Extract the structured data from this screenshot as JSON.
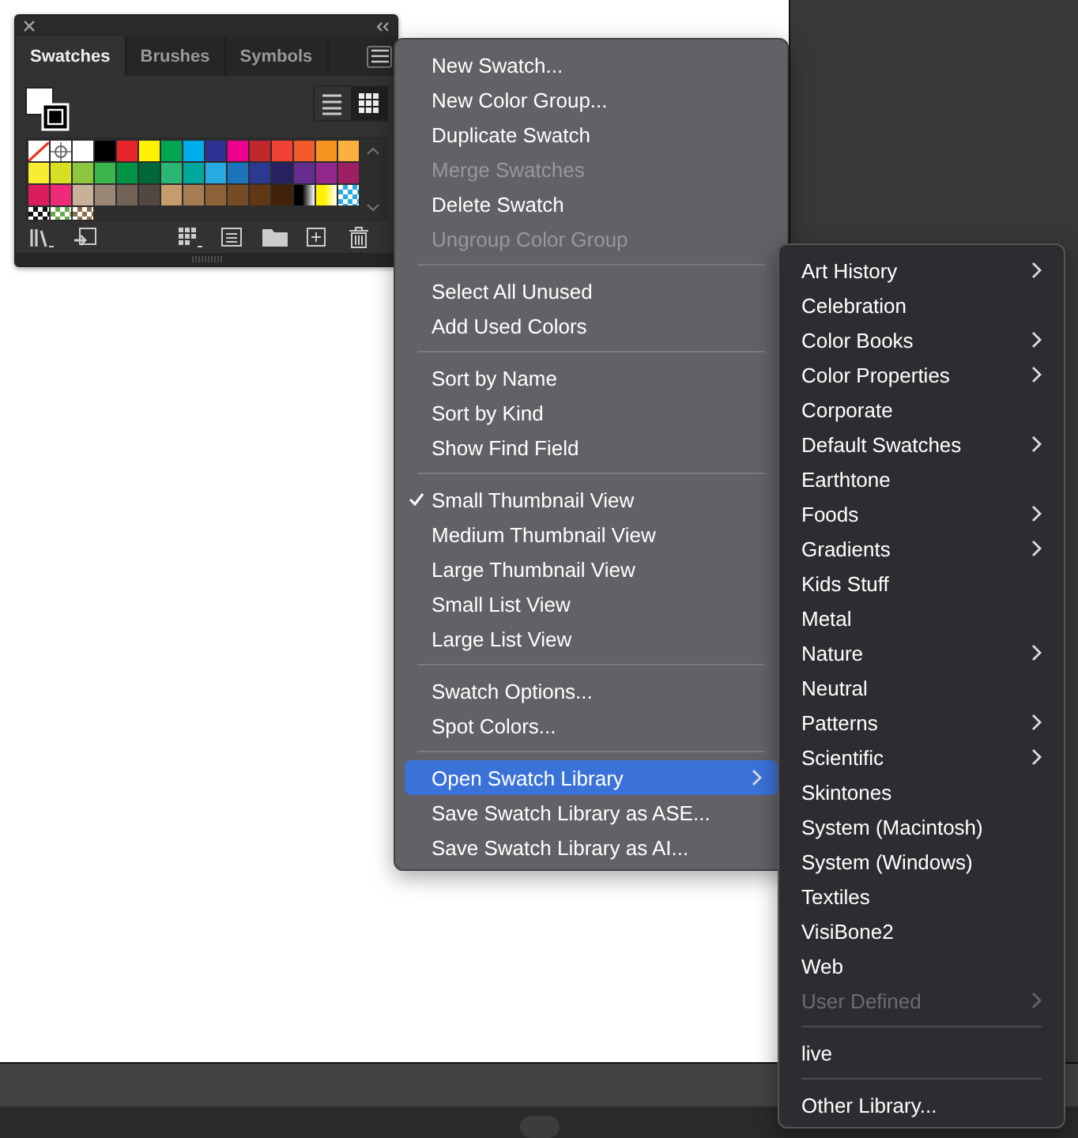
{
  "panel": {
    "tabs": [
      {
        "label": "Swatches",
        "selected": true
      },
      {
        "label": "Brushes",
        "selected": false
      },
      {
        "label": "Symbols",
        "selected": false
      }
    ],
    "views": [
      {
        "kind": "list",
        "selected": false
      },
      {
        "kind": "grid",
        "selected": true
      }
    ],
    "swatches": [
      {
        "kind": "none"
      },
      {
        "kind": "registration"
      },
      {
        "kind": "color",
        "color": "#ffffff"
      },
      {
        "kind": "color",
        "color": "#000000"
      },
      {
        "kind": "color",
        "color": "#e8232a"
      },
      {
        "kind": "color",
        "color": "#fff200"
      },
      {
        "kind": "color",
        "color": "#00a651"
      },
      {
        "kind": "color",
        "color": "#00aeef"
      },
      {
        "kind": "color",
        "color": "#2e3192"
      },
      {
        "kind": "color",
        "color": "#ec008c"
      },
      {
        "kind": "color",
        "color": "#c1272d"
      },
      {
        "kind": "color",
        "color": "#ef4136"
      },
      {
        "kind": "color",
        "color": "#f15a29"
      },
      {
        "kind": "color",
        "color": "#f7941d"
      },
      {
        "kind": "color",
        "color": "#fbb040"
      },
      {
        "kind": "color",
        "color": "#f9ed32"
      },
      {
        "kind": "color",
        "color": "#d7df23"
      },
      {
        "kind": "color",
        "color": "#8dc63f"
      },
      {
        "kind": "color",
        "color": "#39b54a"
      },
      {
        "kind": "color",
        "color": "#009444"
      },
      {
        "kind": "color",
        "color": "#006838"
      },
      {
        "kind": "color",
        "color": "#2bb673"
      },
      {
        "kind": "color",
        "color": "#00a79d"
      },
      {
        "kind": "color",
        "color": "#27aae1"
      },
      {
        "kind": "color",
        "color": "#1c75bc"
      },
      {
        "kind": "color",
        "color": "#2b3990"
      },
      {
        "kind": "color",
        "color": "#262262"
      },
      {
        "kind": "color",
        "color": "#662d91"
      },
      {
        "kind": "color",
        "color": "#92278f"
      },
      {
        "kind": "color",
        "color": "#9e1f63"
      },
      {
        "kind": "color",
        "color": "#da1c5c"
      },
      {
        "kind": "color",
        "color": "#ee2a7b"
      },
      {
        "kind": "color",
        "color": "#c7b299"
      },
      {
        "kind": "color",
        "color": "#998675"
      },
      {
        "kind": "color",
        "color": "#736357"
      },
      {
        "kind": "color",
        "color": "#534741"
      },
      {
        "kind": "color",
        "color": "#c69c6d"
      },
      {
        "kind": "color",
        "color": "#a67c52"
      },
      {
        "kind": "color",
        "color": "#8c6239"
      },
      {
        "kind": "color",
        "color": "#754c24"
      },
      {
        "kind": "color",
        "color": "#603813"
      },
      {
        "kind": "color",
        "color": "#42210b"
      },
      {
        "kind": "gradient",
        "color": "#000000"
      },
      {
        "kind": "gradient",
        "color": "#fff200"
      },
      {
        "kind": "pattern",
        "color": "#27aae1"
      },
      {
        "kind": "pattern",
        "color": "#111111"
      },
      {
        "kind": "pattern",
        "color": "#6aa84f"
      },
      {
        "kind": "pattern",
        "color": "#8b6b4a"
      }
    ]
  },
  "menu": [
    {
      "kind": "item",
      "label": "New Swatch...",
      "disabled": false,
      "checked": false,
      "submenu": false,
      "selected": false
    },
    {
      "kind": "item",
      "label": "New Color Group...",
      "disabled": false,
      "checked": false,
      "submenu": false,
      "selected": false
    },
    {
      "kind": "item",
      "label": "Duplicate Swatch",
      "disabled": false,
      "checked": false,
      "submenu": false,
      "selected": false
    },
    {
      "kind": "item",
      "label": "Merge Swatches",
      "disabled": true,
      "checked": false,
      "submenu": false,
      "selected": false
    },
    {
      "kind": "item",
      "label": "Delete Swatch",
      "disabled": false,
      "checked": false,
      "submenu": false,
      "selected": false
    },
    {
      "kind": "item",
      "label": "Ungroup Color Group",
      "disabled": true,
      "checked": false,
      "submenu": false,
      "selected": false
    },
    {
      "kind": "separator"
    },
    {
      "kind": "item",
      "label": "Select All Unused",
      "disabled": false,
      "checked": false,
      "submenu": false,
      "selected": false
    },
    {
      "kind": "item",
      "label": "Add Used Colors",
      "disabled": false,
      "checked": false,
      "submenu": false,
      "selected": false
    },
    {
      "kind": "separator"
    },
    {
      "kind": "item",
      "label": "Sort by Name",
      "disabled": false,
      "checked": false,
      "submenu": false,
      "selected": false
    },
    {
      "kind": "item",
      "label": "Sort by Kind",
      "disabled": false,
      "checked": false,
      "submenu": false,
      "selected": false
    },
    {
      "kind": "item",
      "label": "Show Find Field",
      "disabled": false,
      "checked": false,
      "submenu": false,
      "selected": false
    },
    {
      "kind": "separator"
    },
    {
      "kind": "item",
      "label": "Small Thumbnail View",
      "disabled": false,
      "checked": true,
      "submenu": false,
      "selected": false
    },
    {
      "kind": "item",
      "label": "Medium Thumbnail View",
      "disabled": false,
      "checked": false,
      "submenu": false,
      "selected": false
    },
    {
      "kind": "item",
      "label": "Large Thumbnail View",
      "disabled": false,
      "checked": false,
      "submenu": false,
      "selected": false
    },
    {
      "kind": "item",
      "label": "Small List View",
      "disabled": false,
      "checked": false,
      "submenu": false,
      "selected": false
    },
    {
      "kind": "item",
      "label": "Large List View",
      "disabled": false,
      "checked": false,
      "submenu": false,
      "selected": false
    },
    {
      "kind": "separator"
    },
    {
      "kind": "item",
      "label": "Swatch Options...",
      "disabled": false,
      "checked": false,
      "submenu": false,
      "selected": false
    },
    {
      "kind": "item",
      "label": "Spot Colors...",
      "disabled": false,
      "checked": false,
      "submenu": false,
      "selected": false
    },
    {
      "kind": "separator"
    },
    {
      "kind": "item",
      "label": "Open Swatch Library",
      "disabled": false,
      "checked": false,
      "submenu": true,
      "selected": true
    },
    {
      "kind": "item",
      "label": "Save Swatch Library as ASE...",
      "disabled": false,
      "checked": false,
      "submenu": false,
      "selected": false
    },
    {
      "kind": "item",
      "label": "Save Swatch Library as AI...",
      "disabled": false,
      "checked": false,
      "submenu": false,
      "selected": false
    }
  ],
  "submenu": [
    {
      "kind": "item",
      "label": "Art History",
      "disabled": false,
      "submenu": true
    },
    {
      "kind": "item",
      "label": "Celebration",
      "disabled": false,
      "submenu": false
    },
    {
      "kind": "item",
      "label": "Color Books",
      "disabled": false,
      "submenu": true
    },
    {
      "kind": "item",
      "label": "Color Properties",
      "disabled": false,
      "submenu": true
    },
    {
      "kind": "item",
      "label": "Corporate",
      "disabled": false,
      "submenu": false
    },
    {
      "kind": "item",
      "label": "Default Swatches",
      "disabled": false,
      "submenu": true
    },
    {
      "kind": "item",
      "label": "Earthtone",
      "disabled": false,
      "submenu": false
    },
    {
      "kind": "item",
      "label": "Foods",
      "disabled": false,
      "submenu": true
    },
    {
      "kind": "item",
      "label": "Gradients",
      "disabled": false,
      "submenu": true
    },
    {
      "kind": "item",
      "label": "Kids Stuff",
      "disabled": false,
      "submenu": false
    },
    {
      "kind": "item",
      "label": "Metal",
      "disabled": false,
      "submenu": false
    },
    {
      "kind": "item",
      "label": "Nature",
      "disabled": false,
      "submenu": true
    },
    {
      "kind": "item",
      "label": "Neutral",
      "disabled": false,
      "submenu": false
    },
    {
      "kind": "item",
      "label": "Patterns",
      "disabled": false,
      "submenu": true
    },
    {
      "kind": "item",
      "label": "Scientific",
      "disabled": false,
      "submenu": true
    },
    {
      "kind": "item",
      "label": "Skintones",
      "disabled": false,
      "submenu": false
    },
    {
      "kind": "item",
      "label": "System (Macintosh)",
      "disabled": false,
      "submenu": false
    },
    {
      "kind": "item",
      "label": "System (Windows)",
      "disabled": false,
      "submenu": false
    },
    {
      "kind": "item",
      "label": "Textiles",
      "disabled": false,
      "submenu": false
    },
    {
      "kind": "item",
      "label": "VisiBone2",
      "disabled": false,
      "submenu": false
    },
    {
      "kind": "item",
      "label": "Web",
      "disabled": false,
      "submenu": false
    },
    {
      "kind": "item",
      "label": "User Defined",
      "disabled": true,
      "submenu": true
    },
    {
      "kind": "separator"
    },
    {
      "kind": "item",
      "label": "live",
      "disabled": false,
      "submenu": false
    },
    {
      "kind": "separator"
    },
    {
      "kind": "item",
      "label": "Other Library...",
      "disabled": false,
      "submenu": false
    }
  ]
}
